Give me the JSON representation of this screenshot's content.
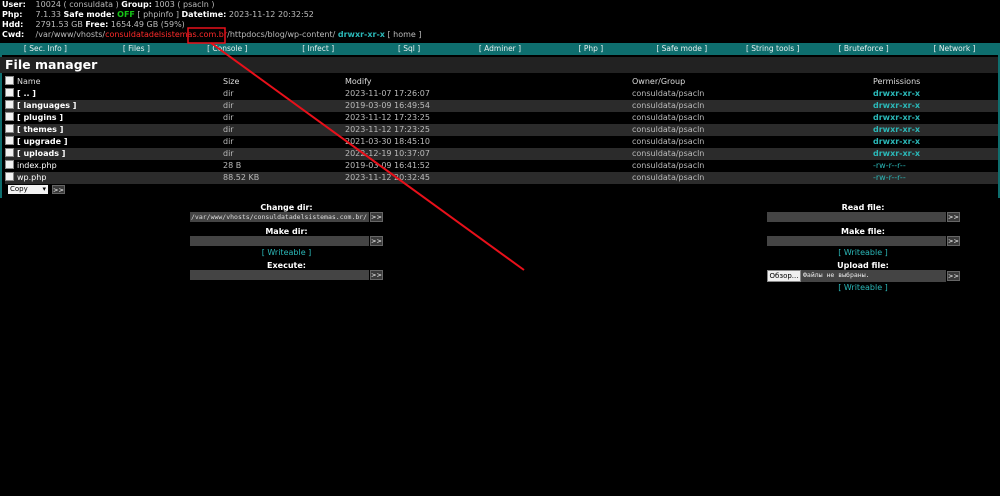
{
  "header": {
    "user_label": "User:",
    "user_value": "10024 ( consuldata )",
    "group_label": "Group:",
    "group_value": "1003 ( psacln )",
    "php_label": "Php:",
    "php_version": "7.1.33",
    "safe_mode_label": "Safe mode:",
    "safe_mode_value": "OFF",
    "phpinfo_link": "[ phpinfo ]",
    "datetime_label": "Datetime:",
    "datetime_value": "2023-11-12 20:32:52",
    "hdd_label": "Hdd:",
    "hdd_total": "2791.53 GB",
    "free_label": "Free:",
    "free_value": "1654.49 GB (59%)",
    "cwd_label": "Cwd:",
    "cwd_prefix": "/var/www/vhosts/",
    "cwd_redacted": "consuldatadelsistemas.com.br",
    "cwd_sep": "/",
    "cwd_seg_httpdocs": "httpdocs/",
    "cwd_seg_blog": "blog/",
    "cwd_seg_wpcontent": "wp-content/",
    "cwd_perms": "drwxr-xr-x",
    "home_link": "[ home ]"
  },
  "menu": [
    "[ Sec. Info ]",
    "[ Files ]",
    "[ Console ]",
    "[ Infect ]",
    "[ Sql ]",
    "[ Adminer ]",
    "[ Php ]",
    "[ Safe mode ]",
    "[ String tools ]",
    "[ Bruteforce ]",
    "[ Network ]"
  ],
  "file_manager": {
    "title": "File manager",
    "columns": {
      "name": "Name",
      "size": "Size",
      "modify": "Modify",
      "owner": "Owner/Group",
      "perms": "Permissions"
    },
    "rows": [
      {
        "name": "[ .. ]",
        "size": "dir",
        "modify": "2023-11-07 17:26:07",
        "owner": "consuldata/psacln",
        "perms": "drwxr-xr-x",
        "is_dir": true
      },
      {
        "name": "[ languages ]",
        "size": "dir",
        "modify": "2019-03-09 16:49:54",
        "owner": "consuldata/psacln",
        "perms": "drwxr-xr-x",
        "is_dir": true
      },
      {
        "name": "[ plugins ]",
        "size": "dir",
        "modify": "2023-11-12 17:23:25",
        "owner": "consuldata/psacln",
        "perms": "drwxr-xr-x",
        "is_dir": true
      },
      {
        "name": "[ themes ]",
        "size": "dir",
        "modify": "2023-11-12 17:23:25",
        "owner": "consuldata/psacln",
        "perms": "drwxr-xr-x",
        "is_dir": true
      },
      {
        "name": "[ upgrade ]",
        "size": "dir",
        "modify": "2021-03-30 18:45:10",
        "owner": "consuldata/psacln",
        "perms": "drwxr-xr-x",
        "is_dir": true
      },
      {
        "name": "[ uploads ]",
        "size": "dir",
        "modify": "2022-12-19 10:37:07",
        "owner": "consuldata/psacln",
        "perms": "drwxr-xr-x",
        "is_dir": true
      },
      {
        "name": "index.php",
        "size": "28 B",
        "modify": "2019-03-09 16:41:52",
        "owner": "consuldata/psacln",
        "perms": "-rw-r--r--",
        "is_dir": false
      },
      {
        "name": "wp.php",
        "size": "88.52 KB",
        "modify": "2023-11-12 20:32:45",
        "owner": "consuldata/psacln",
        "perms": "-rw-r--r--",
        "is_dir": false
      }
    ],
    "action_select": "Copy",
    "action_go": ">>"
  },
  "forms": {
    "change_dir_label": "Change dir:",
    "change_dir_value": "/var/www/vhosts/consuldatadelsistemas.com.br/",
    "make_dir_label": "Make dir:",
    "make_dir_writeable": "[ Writeable ]",
    "execute_label": "Execute:",
    "read_file_label": "Read file:",
    "make_file_label": "Make file:",
    "make_file_writeable": "[ Writeable ]",
    "upload_label": "Upload file:",
    "upload_browse": "Обзор...",
    "upload_status": "Файлы не выбраны.",
    "upload_writeable": "[ Writeable ]",
    "go": ">>"
  },
  "colors": {
    "accent": "#0e6e6e",
    "link": "#2bb8b8",
    "annotation": "#e8101a",
    "safe_off": "#16c516"
  }
}
